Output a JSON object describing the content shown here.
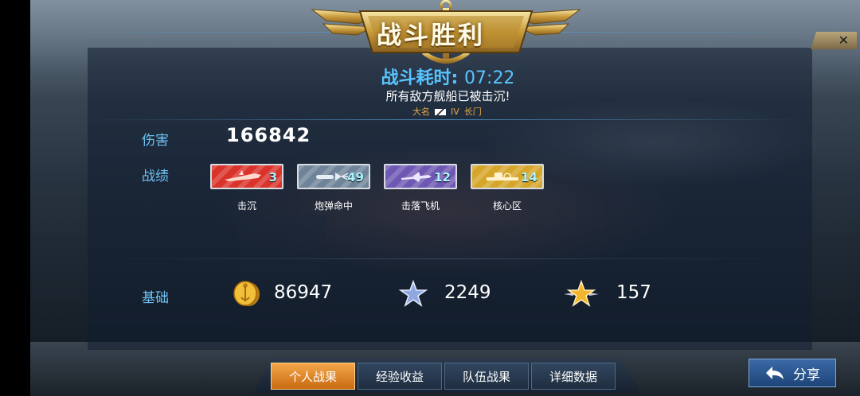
{
  "header": {
    "title": "战斗胜利",
    "close_label": "✕"
  },
  "summary": {
    "time_label": "战斗耗时:",
    "time_value": "07:22",
    "result_text": "所有敌方舰船已被击沉!",
    "ship_name": "大名",
    "ship_tier": "IV",
    "ship_rank": "长门"
  },
  "damage": {
    "label": "伤害",
    "value": "166842"
  },
  "achievements": {
    "label": "战绩",
    "items": [
      {
        "name": "击沉",
        "count": "3",
        "color": "#d9332b",
        "icon": "ship-sunk-icon"
      },
      {
        "name": "炮弹命中",
        "count": "49",
        "color": "#6f8499",
        "icon": "shell-hit-icon"
      },
      {
        "name": "击落飞机",
        "count": "12",
        "color": "#6f58b3",
        "icon": "plane-down-icon"
      },
      {
        "name": "核心区",
        "count": "14",
        "color": "#d6a62b",
        "icon": "citadel-icon"
      }
    ]
  },
  "base": {
    "label": "基础",
    "coins": "86947",
    "exp": "2249",
    "elite_exp": "157"
  },
  "tabs": [
    {
      "label": "个人战果",
      "active": true
    },
    {
      "label": "经验收益",
      "active": false
    },
    {
      "label": "队伍战果",
      "active": false
    },
    {
      "label": "详细数据",
      "active": false
    }
  ],
  "share": {
    "label": "分享"
  }
}
